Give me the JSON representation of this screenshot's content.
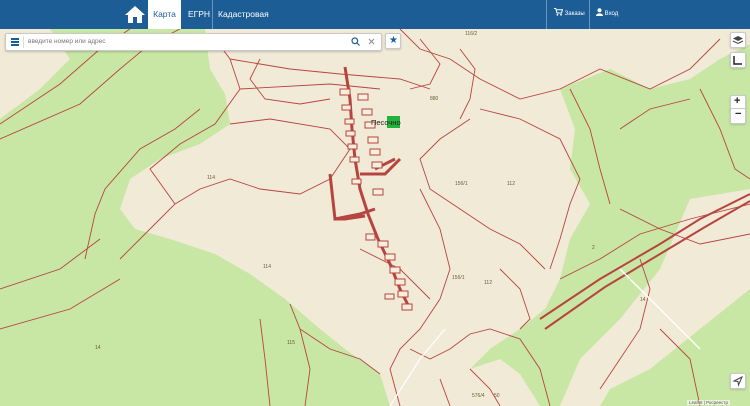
{
  "nav": {
    "home_icon": "home-icon",
    "tabs": [
      {
        "label": "Карта"
      },
      {
        "label": "ЕГРН"
      },
      {
        "label": "Кадастровая стоимость"
      }
    ],
    "orders_label": "Заказы",
    "login_label": "Вход"
  },
  "search": {
    "placeholder": "введите номер или адрес"
  },
  "map": {
    "place_label": "Песочно",
    "parcel_labels": [
      "116/2",
      "880",
      "114",
      "114",
      "115",
      "14",
      "15б/1",
      "112",
      "15б/1",
      "112",
      "2",
      "14",
      "576/4",
      "50"
    ],
    "attribution": "Leaflet | Росреестр"
  },
  "colors": {
    "header": "#1d5d95",
    "forest": "#c8e6a4",
    "clearing": "#f1ead7",
    "boundary": "#b84440",
    "marker": "#22b33b"
  }
}
